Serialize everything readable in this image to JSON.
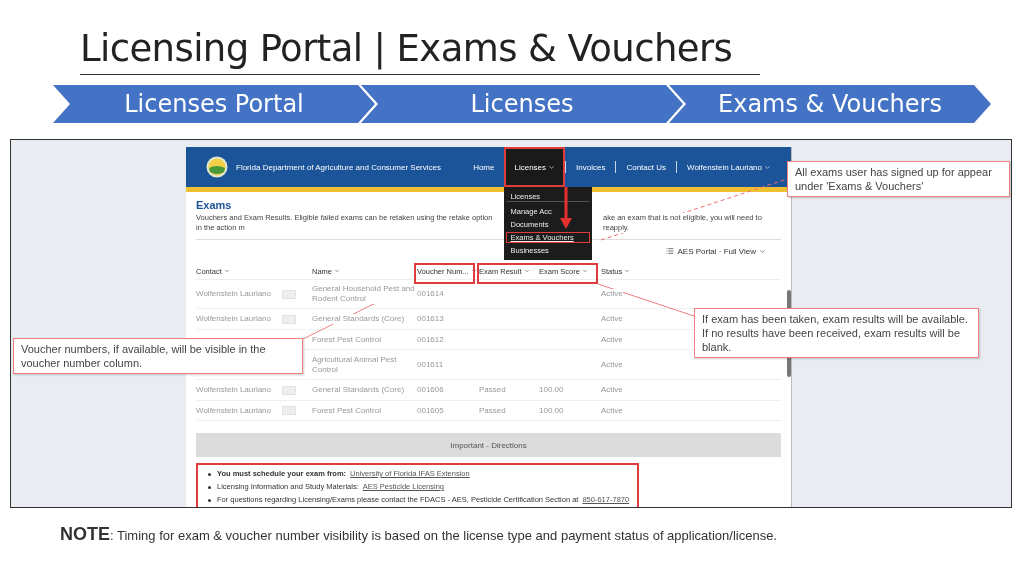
{
  "title": "Licensing Portal | Exams & Vouchers",
  "breadcrumb": [
    {
      "label": "Licenses Portal"
    },
    {
      "label": "Licenses"
    },
    {
      "label": "Exams & Vouchers"
    }
  ],
  "screenshot": {
    "site_title": "Florida Department of Agriculture and Consumer Services",
    "nav": [
      {
        "label": "Home",
        "dropdown": false,
        "expanded": false
      },
      {
        "label": "Licenses",
        "dropdown": true,
        "expanded": true
      },
      {
        "label": "Invoices",
        "dropdown": false,
        "expanded": false
      },
      {
        "label": "Contact Us",
        "dropdown": false,
        "expanded": false
      },
      {
        "label": "Wolfenstein Lauriano",
        "dropdown": true,
        "expanded": false
      }
    ],
    "menu": [
      {
        "label": "Licenses",
        "selected": false
      },
      {
        "label": "Manage Acc",
        "selected": false
      },
      {
        "label": "Documents",
        "selected": false
      },
      {
        "label": "Exams & Vouchers",
        "selected": true
      },
      {
        "label": "Businesses",
        "selected": false
      }
    ],
    "heading": "Exams",
    "description": [
      "Vouchers and Exam Results. Eligible failed exams can be retaken using the retake option in the action m",
      "ake an exam that is not eligible, you will need to reapply."
    ],
    "view": "AES Portal · Full View",
    "columns": [
      "Contact",
      "Name",
      "Voucher Num...",
      "Exam Result",
      "Exam Score",
      "Status"
    ],
    "rows": [
      {
        "contact": "Wolfenstein Lauriano",
        "name": "General Household Pest and Rodent Control",
        "voucher": "001614",
        "status": "Active"
      },
      {
        "contact": "Wolfenstein Lauriano",
        "name": "General Standards (Core)",
        "voucher": "001613",
        "status": "Active"
      },
      {
        "name": "Forest Pest Control",
        "voucher": "001612",
        "status": "Active"
      },
      {
        "name": "Agricultural Animal Pest Control",
        "voucher": "001611",
        "status": "Active"
      },
      {
        "contact": "Wolfenstein Lauriano",
        "name": "General Standards (Core)",
        "voucher": "001606",
        "result": "Passed",
        "score": "100.00",
        "status": "Active"
      },
      {
        "contact": "Wolfenstein Lauriano",
        "name": "Forest Pest Control",
        "voucher": "001605",
        "result": "Passed",
        "score": "100.00",
        "status": "Active"
      }
    ],
    "directions_title": "Important - Directions",
    "directions": [
      {
        "text": "**You must schedule your exam from:**",
        "link": "University of Florida IFAS Extension"
      },
      {
        "text": "Licensing Information and Study Materials:",
        "link": "AES Pesticide Licensing"
      },
      {
        "text": "For questions regarding Licensing/Exams please contact the FDACS - AES, Pesticide Certification Section at",
        "link": "850-617-7870"
      }
    ]
  },
  "callouts": [
    "All exams user has signed up for appear under 'Exams & Vouchers'",
    "If exam has been taken, exam results will be available.  If no results have been received, exam results will be blank.",
    "Voucher numbers, if available, will be visible in the voucher number column."
  ],
  "note": {
    "label": "NOTE",
    "text": ": Timing for exam & voucher number visibility is based on the license type and payment status of application/license."
  }
}
